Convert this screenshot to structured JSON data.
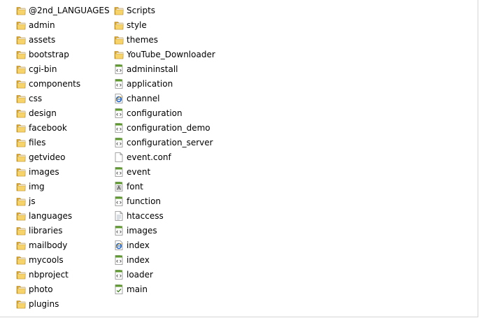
{
  "columns": [
    {
      "items": [
        {
          "name": "@2nd_LANGUAGES",
          "icon": "folder-icon"
        },
        {
          "name": "admin",
          "icon": "folder-icon"
        },
        {
          "name": "assets",
          "icon": "folder-icon"
        },
        {
          "name": "bootstrap",
          "icon": "folder-icon"
        },
        {
          "name": "cgi-bin",
          "icon": "folder-icon"
        },
        {
          "name": "components",
          "icon": "folder-icon"
        },
        {
          "name": "css",
          "icon": "folder-icon"
        },
        {
          "name": "design",
          "icon": "folder-icon"
        },
        {
          "name": "facebook",
          "icon": "folder-icon"
        },
        {
          "name": "files",
          "icon": "folder-icon"
        },
        {
          "name": "getvideo",
          "icon": "folder-icon"
        },
        {
          "name": "images",
          "icon": "folder-icon"
        },
        {
          "name": "img",
          "icon": "folder-icon"
        },
        {
          "name": "js",
          "icon": "folder-icon"
        },
        {
          "name": "languages",
          "icon": "folder-icon"
        },
        {
          "name": "libraries",
          "icon": "folder-icon"
        },
        {
          "name": "mailbody",
          "icon": "folder-icon"
        },
        {
          "name": "mycools",
          "icon": "folder-icon"
        },
        {
          "name": "nbproject",
          "icon": "folder-icon"
        },
        {
          "name": "photo",
          "icon": "folder-icon"
        },
        {
          "name": "plugins",
          "icon": "folder-icon"
        }
      ]
    },
    {
      "items": [
        {
          "name": "Scripts",
          "icon": "folder-icon"
        },
        {
          "name": "style",
          "icon": "folder-icon"
        },
        {
          "name": "themes",
          "icon": "folder-icon"
        },
        {
          "name": "YouTube_Downloader",
          "icon": "folder-icon"
        },
        {
          "name": "admininstall",
          "icon": "script-file-icon"
        },
        {
          "name": "application",
          "icon": "script-file-icon"
        },
        {
          "name": "channel",
          "icon": "ie-html-file-icon"
        },
        {
          "name": "configuration",
          "icon": "script-file-icon"
        },
        {
          "name": "configuration_demo",
          "icon": "script-file-icon"
        },
        {
          "name": "configuration_server",
          "icon": "script-file-icon"
        },
        {
          "name": "event.conf",
          "icon": "blank-file-icon"
        },
        {
          "name": "event",
          "icon": "script-file-icon"
        },
        {
          "name": "font",
          "icon": "font-file-icon"
        },
        {
          "name": "function",
          "icon": "script-file-icon"
        },
        {
          "name": "htaccess",
          "icon": "text-file-icon"
        },
        {
          "name": "images",
          "icon": "script-file-icon"
        },
        {
          "name": "index",
          "icon": "ie-html-file-icon"
        },
        {
          "name": "index",
          "icon": "script-file-icon"
        },
        {
          "name": "loader",
          "icon": "script-file-icon"
        },
        {
          "name": "main",
          "icon": "checked-file-icon"
        }
      ]
    }
  ],
  "colors": {
    "folder_back": "#d9a52c",
    "folder_front": "#f6d36b",
    "file_green": "#5e9a2e",
    "ie_blue": "#1d63c8"
  }
}
